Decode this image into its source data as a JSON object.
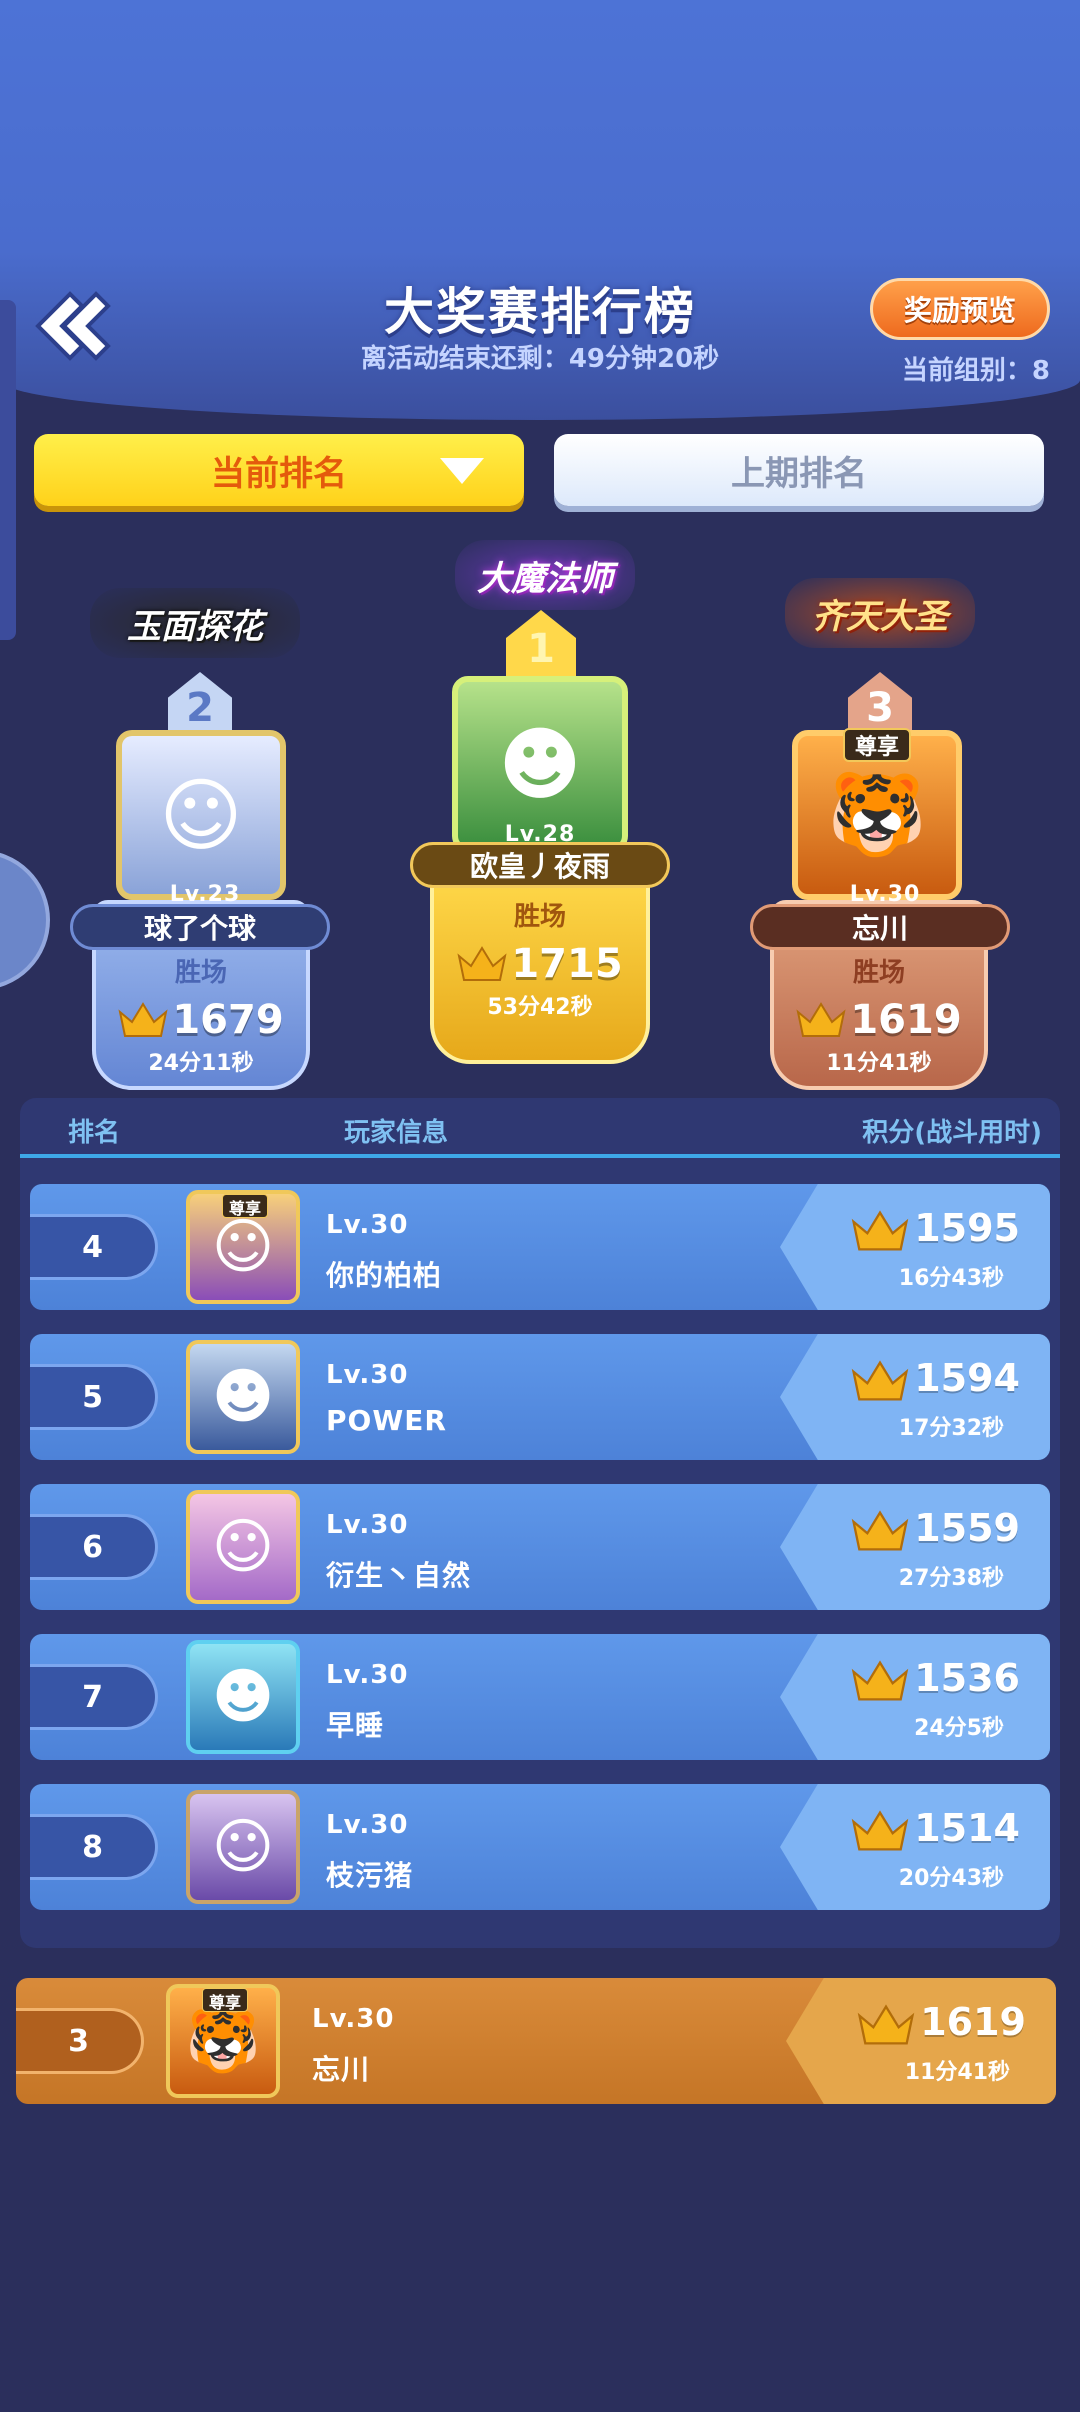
{
  "header": {
    "title": "大奖赛排行榜",
    "countdown": "离活动结束还剩：49分钟20秒",
    "reward_button": "奖励预览",
    "group": "当前组别：8"
  },
  "tabs": {
    "current": "当前排名",
    "previous": "上期排名"
  },
  "podium": {
    "label": "胜场",
    "first": {
      "rank": "1",
      "title_badge": "大魔法师",
      "level": "Lv.28",
      "name": "欧皇丿夜雨",
      "score": "1715",
      "time": "53分42秒"
    },
    "second": {
      "rank": "2",
      "title_badge": "玉面探花",
      "level": "Lv.23",
      "name": "球了个球",
      "score": "1679",
      "time": "24分11秒"
    },
    "third": {
      "rank": "3",
      "title_badge": "齐天大圣",
      "level": "Lv.30",
      "name": "忘川",
      "score": "1619",
      "time": "11分41秒",
      "vip_badge": "尊享"
    }
  },
  "list_header": {
    "rank": "排名",
    "info": "玩家信息",
    "score": "积分(战斗用时)"
  },
  "rows": [
    {
      "rank": "4",
      "level": "Lv.30",
      "name": "你的柏柏",
      "score": "1595",
      "time": "16分43秒",
      "vip_badge": "尊享"
    },
    {
      "rank": "5",
      "level": "Lv.30",
      "name": "POWER",
      "score": "1594",
      "time": "17分32秒"
    },
    {
      "rank": "6",
      "level": "Lv.30",
      "name": "衍生丶自然",
      "score": "1559",
      "time": "27分38秒"
    },
    {
      "rank": "7",
      "level": "Lv.30",
      "name": "早睡",
      "score": "1536",
      "time": "24分5秒"
    },
    {
      "rank": "8",
      "level": "Lv.30",
      "name": "枝污猪",
      "score": "1514",
      "time": "20分43秒"
    }
  ],
  "my_row": {
    "rank": "3",
    "level": "Lv.30",
    "name": "忘川",
    "score": "1619",
    "time": "11分41秒",
    "vip_badge": "尊享"
  },
  "colors": {
    "header_blue": "#4d73d6",
    "tab_yellow": "#ffd21a",
    "row_blue": "#5f98ea",
    "my_row_orange": "#d98b3a",
    "crown_gold": "#f5b21a"
  },
  "icons": [
    "back-arrow-icon",
    "dropdown-triangle-icon",
    "crown-icon"
  ]
}
